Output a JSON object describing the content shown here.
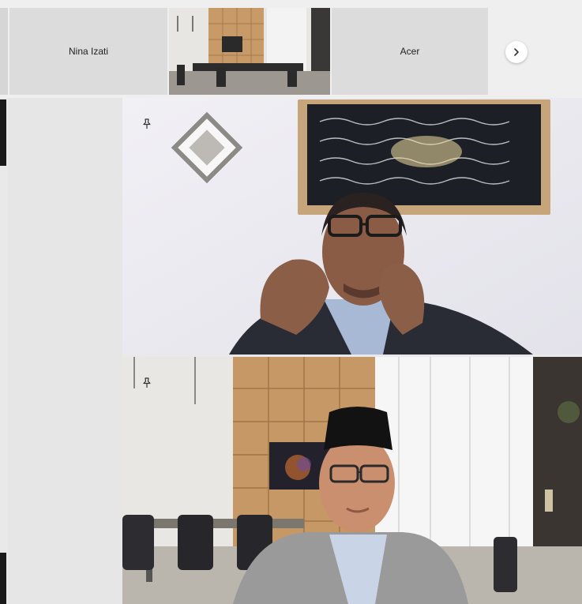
{
  "strip": {
    "participants": [
      {
        "name": "Nina Izati"
      },
      {
        "name": ""
      },
      {
        "name": "Acer"
      }
    ],
    "next_icon": "chevron-right-icon"
  },
  "main": {
    "pin_icon": "pin-icon",
    "colors": {
      "background": "#e9e9e9",
      "tile": "#dcdcdc"
    }
  }
}
